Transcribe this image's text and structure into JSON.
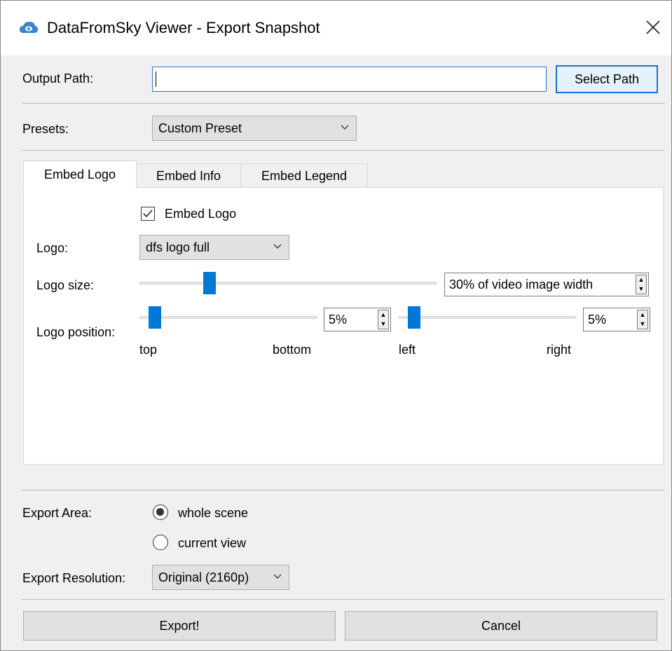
{
  "window": {
    "title": "DataFromSky Viewer - Export Snapshot",
    "app_icon": "cloud-eye-icon",
    "close_icon": "close-icon"
  },
  "output": {
    "label": "Output Path:",
    "value": "",
    "select_button": "Select Path"
  },
  "presets": {
    "label": "Presets:",
    "selected": "Custom Preset"
  },
  "tabs": [
    {
      "label": "Embed Logo",
      "active": true
    },
    {
      "label": "Embed Info",
      "active": false
    },
    {
      "label": "Embed Legend",
      "active": false
    }
  ],
  "embed_logo": {
    "checkbox_label": "Embed Logo",
    "checked": true,
    "logo_label": "Logo:",
    "logo_selected": "dfs logo full",
    "size_label": "Logo size:",
    "size_value": "30% of video image width",
    "size_level_percent": 30,
    "position_label": "Logo position:",
    "vertical": {
      "value": "5%",
      "level_percent": 5,
      "min_label": "top",
      "max_label": "bottom"
    },
    "horizontal": {
      "value": "5%",
      "level_percent": 5,
      "min_label": "left",
      "max_label": "right"
    }
  },
  "export_area": {
    "label": "Export Area:",
    "options": [
      {
        "label": "whole scene",
        "selected": true
      },
      {
        "label": "current view",
        "selected": false
      }
    ]
  },
  "export_resolution": {
    "label": "Export Resolution:",
    "selected": "Original (2160p)"
  },
  "actions": {
    "export": "Export!",
    "cancel": "Cancel"
  },
  "colors": {
    "accent": "#0078d7",
    "focus_border": "#1f6fcf",
    "dialog_bg": "#f0f0f0"
  }
}
